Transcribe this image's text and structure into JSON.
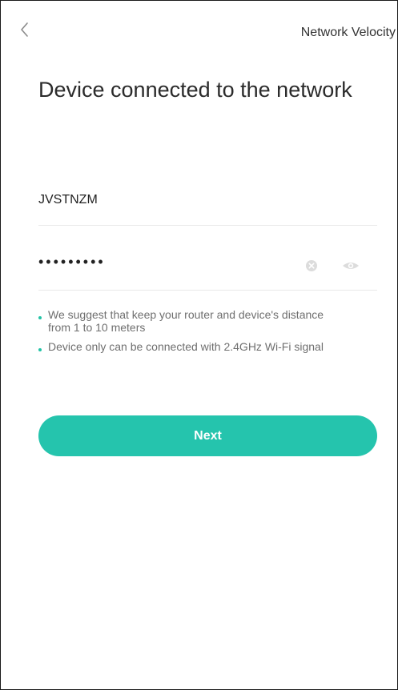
{
  "nav": {
    "back_icon": "chevron-left-icon",
    "right_label": "Network Velocity"
  },
  "title": "Device connected to the network",
  "ssid": {
    "value": "JVSTNZM"
  },
  "password": {
    "masked_value": "•••••••••",
    "clear_icon": "clear-circle-icon",
    "visibility_icon": "eye-icon"
  },
  "tips": [
    {
      "text": "We suggest that keep your router and device's distance from 1 to 10 meters"
    },
    {
      "text": "Device only can be connected with 2.4GHz Wi-Fi signal"
    }
  ],
  "next_button": {
    "label": "Next"
  },
  "colors": {
    "accent": "#25c4ad",
    "tip_dot": "#22c3a6",
    "tip_text": "#6f6f6f",
    "icon_gray": "#dcdcdc"
  }
}
